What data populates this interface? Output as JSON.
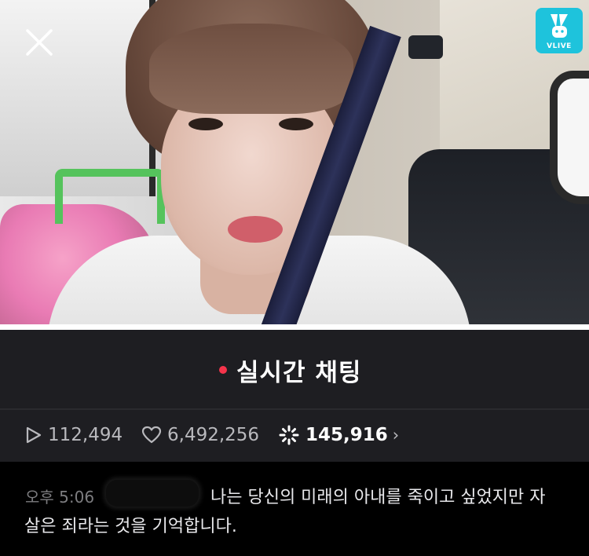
{
  "video": {
    "logo_text": "VLIVE",
    "logo_color": "#1ec3dc"
  },
  "chat_header": {
    "title": "실시간 채팅",
    "live_dot_color": "#f5344b",
    "close_icon": "close-icon"
  },
  "stats": {
    "plays": "112,494",
    "likes": "6,492,256",
    "hearts": "145,916",
    "chevron": "›"
  },
  "message": {
    "time": "오후 5:06",
    "text_line1": "나는 당신의 미래의 아내를 죽이고 싶었지만 자",
    "text_line2": "살은 죄라는 것을 기억합니다."
  }
}
